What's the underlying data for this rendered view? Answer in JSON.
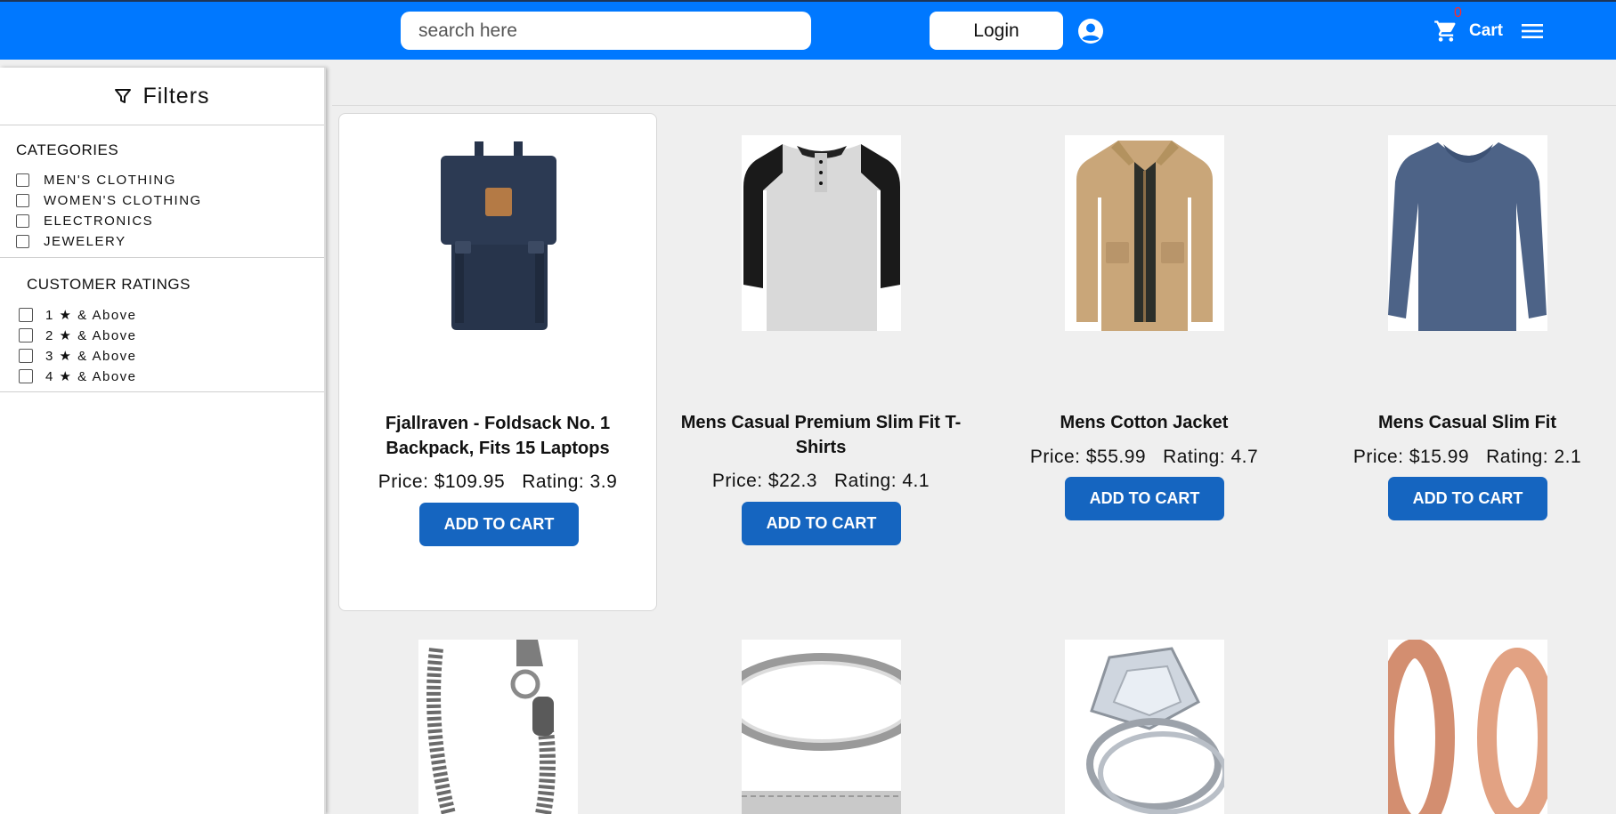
{
  "header": {
    "search_placeholder": "search here",
    "login_label": "Login",
    "cart_label": "Cart",
    "cart_count": "0"
  },
  "sidebar": {
    "title": "Filters",
    "categories_title": "CATEGORIES",
    "categories": [
      "MEN'S CLOTHING",
      "WOMEN'S CLOTHING",
      "ELECTRONICS",
      "JEWELERY"
    ],
    "ratings_title": "CUSTOMER RATINGS",
    "ratings": [
      "1 ★ & Above",
      "2 ★ & Above",
      "3 ★ & Above",
      "4 ★ & Above"
    ]
  },
  "products": [
    {
      "title": "Fjallraven - Foldsack No. 1 Backpack, Fits 15 Laptops",
      "price": "Price: $109.95",
      "rating": "Rating: 3.9",
      "button": "ADD TO CART"
    },
    {
      "title": "Mens Casual Premium Slim Fit T-Shirts",
      "price": "Price: $22.3",
      "rating": "Rating: 4.1",
      "button": "ADD TO CART"
    },
    {
      "title": "Mens Cotton Jacket",
      "price": "Price: $55.99",
      "rating": "Rating: 4.7",
      "button": "ADD TO CART"
    },
    {
      "title": "Mens Casual Slim Fit",
      "price": "Price: $15.99",
      "rating": "Rating: 2.1",
      "button": "ADD TO CART"
    }
  ],
  "colors": {
    "header": "#0078ff",
    "button": "#1565c0",
    "cart_count": "#ff2a2a"
  }
}
